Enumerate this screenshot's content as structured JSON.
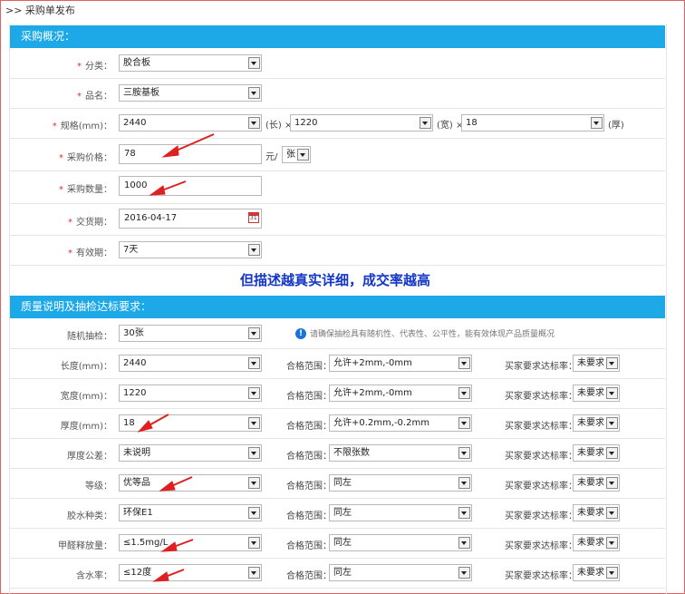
{
  "breadcrumb": ">> 采购单发布",
  "section1_title": "采购概况：",
  "section2_title": "质量说明及抽检达标要求：",
  "slogan": "但描述越真实详细，成交率越高",
  "required_mark": "*",
  "basic": {
    "category": {
      "label": "分类：",
      "value": "胶合板"
    },
    "product": {
      "label": "品名：",
      "value": "三胺基板"
    },
    "spec": {
      "label": "规格(mm)：",
      "length": "2440",
      "length_unit": "(长) ×",
      "width": "1220",
      "width_unit": "(宽) ×",
      "thickness": "18",
      "thickness_unit": "(厚)"
    },
    "price": {
      "label": "采购价格：",
      "value": "78",
      "unit": "元/",
      "per": "张"
    },
    "quantity": {
      "label": "采购数量：",
      "value": "1000"
    },
    "delivery": {
      "label": "交货期：",
      "value": "2016-04-17"
    },
    "validity": {
      "label": "有效期：",
      "value": "7天"
    }
  },
  "quality": {
    "sampling_label": "随机抽检：",
    "sampling_value": "30张",
    "sampling_note": "请确保抽检具有随机性、代表性、公平性，能有效体现产品质量概况",
    "range_label": "合格范围：",
    "rate_label": "买家要求达标率：",
    "rows": [
      {
        "label": "长度(mm)：",
        "value": "2440",
        "range": "允许+2mm,-0mm",
        "rate": "未要求"
      },
      {
        "label": "宽度(mm)：",
        "value": "1220",
        "range": "允许+2mm,-0mm",
        "rate": "未要求"
      },
      {
        "label": "厚度(mm)：",
        "value": "18",
        "range": "允许+0.2mm,-0.2mm",
        "rate": "未要求"
      },
      {
        "label": "厚度公差：",
        "value": "未说明",
        "range": "不限张数",
        "rate": "未要求"
      },
      {
        "label": "等级：",
        "value": "优等品",
        "range": "同左",
        "rate": "未要求"
      },
      {
        "label": "胶水种类：",
        "value": "环保E1",
        "range": "同左",
        "rate": "未要求"
      },
      {
        "label": "甲醛释放量：",
        "value": "≤1.5mg/L",
        "range": "同左",
        "rate": "未要求"
      },
      {
        "label": "含水率：",
        "value": "≤12度",
        "range": "同左",
        "rate": "未要求"
      }
    ]
  },
  "colors": {
    "header_bg": "#1da8e8",
    "slogan": "#1336c8",
    "required": "#e03030",
    "annotation_arrow": "#e02020"
  }
}
